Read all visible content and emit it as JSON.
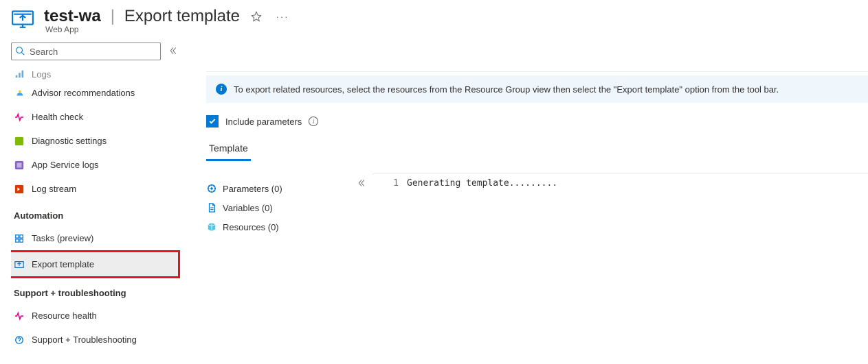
{
  "header": {
    "resource_name": "test-wa",
    "page_title": "Export template",
    "subtitle": "Web App"
  },
  "sidebar": {
    "search_placeholder": "Search",
    "items_top": [
      {
        "label": "Logs"
      },
      {
        "label": "Advisor recommendations"
      },
      {
        "label": "Health check"
      },
      {
        "label": "Diagnostic settings"
      },
      {
        "label": "App Service logs"
      },
      {
        "label": "Log stream"
      }
    ],
    "section_automation": "Automation",
    "items_automation": [
      {
        "label": "Tasks (preview)"
      },
      {
        "label": "Export template"
      }
    ],
    "section_support": "Support + troubleshooting",
    "items_support": [
      {
        "label": "Resource health"
      },
      {
        "label": "Support + Troubleshooting"
      }
    ]
  },
  "main": {
    "info_text": "To export related resources, select the resources from the Resource Group view then select the \"Export template\" option from the tool bar.",
    "include_params_label": "Include parameters",
    "tab_label": "Template",
    "tree": {
      "parameters": "Parameters (0)",
      "variables": "Variables (0)",
      "resources": "Resources (0)"
    },
    "editor": {
      "line_no": "1",
      "line_text": "Generating template........."
    }
  }
}
